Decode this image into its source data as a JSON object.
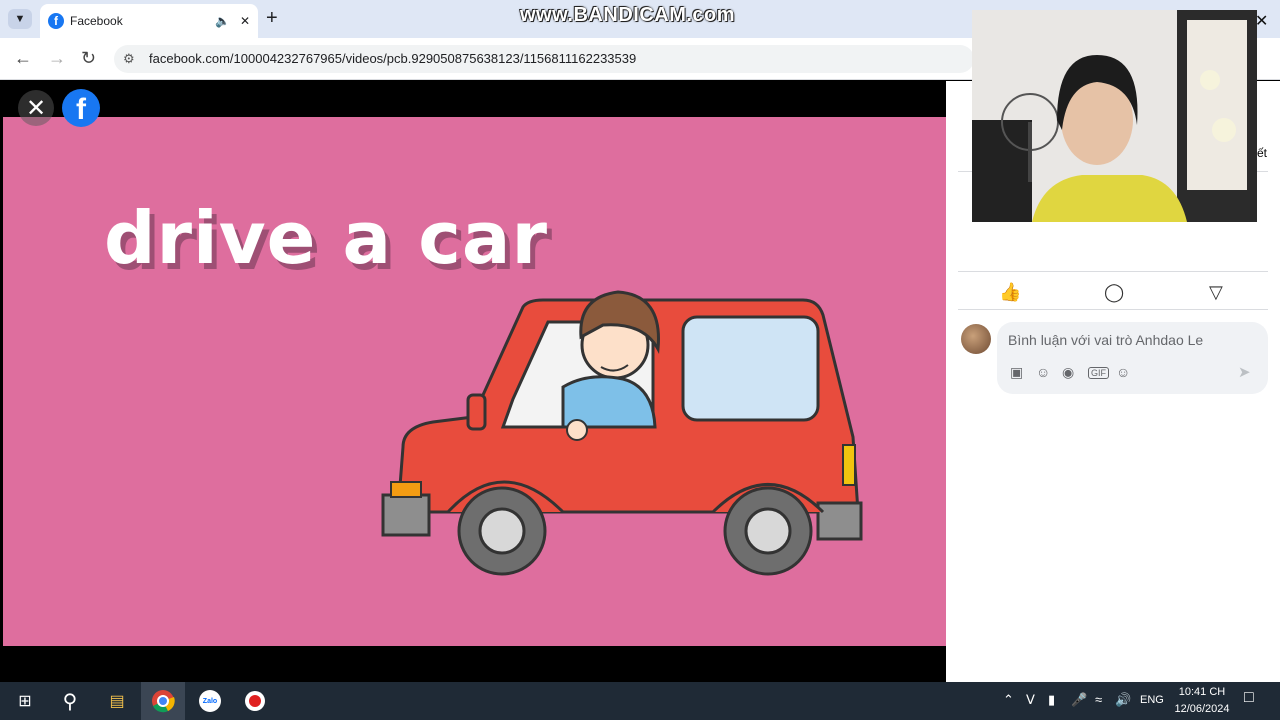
{
  "browser": {
    "tab_title": "Facebook",
    "tab_favicon": "f",
    "url": "facebook.com/100004232767965/videos/pcb.929050875638123/1156811162233539",
    "new_tab_label": "+"
  },
  "recorder_watermark": "www.BANDICAM.com",
  "video": {
    "caption": "drive a car",
    "background_color": "#de6e9e"
  },
  "panel": {
    "partial_text": "ết",
    "comment_placeholder": "Bình luận với vai trò Anhdao Le",
    "gif_label": "GIF"
  },
  "taskbar": {
    "language": "ENG",
    "time": "10:41 CH",
    "date": "12/06/2024",
    "zalo_label": "Zalo"
  },
  "colors": {
    "facebook_blue": "#1877f2",
    "taskbar": "#1f2a36",
    "car_red": "#e84c3d"
  }
}
